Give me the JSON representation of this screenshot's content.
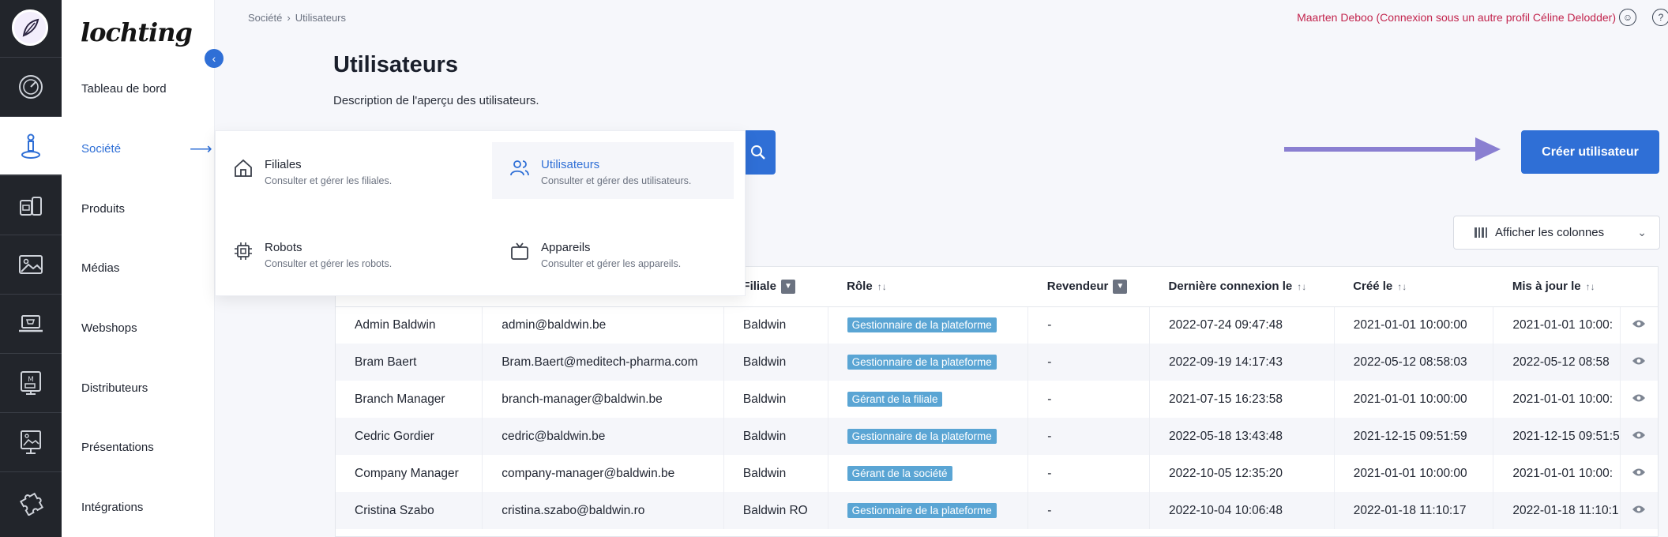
{
  "brand": "lochting",
  "breadcrumb": [
    "Société",
    "Utilisateurs"
  ],
  "user_info": "Maarten Deboo (Connexion sous un autre profil Céline Delodder)",
  "nav": [
    {
      "label": "Tableau de bord"
    },
    {
      "label": "Société"
    },
    {
      "label": "Produits"
    },
    {
      "label": "Médias"
    },
    {
      "label": "Webshops"
    },
    {
      "label": "Distributeurs"
    },
    {
      "label": "Présentations"
    },
    {
      "label": "Intégrations"
    }
  ],
  "page": {
    "title": "Utilisateurs",
    "description": "Description de l'aperçu des utilisateurs.",
    "create_label": "Créer utilisateur",
    "columns_label": "Afficher les colonnes"
  },
  "menu": [
    {
      "title": "Filiales",
      "desc": "Consulter et gérer les filiales."
    },
    {
      "title": "Utilisateurs",
      "desc": "Consulter et gérer des utilisateurs."
    },
    {
      "title": "Robots",
      "desc": "Consulter et gérer les robots."
    },
    {
      "title": "Appareils",
      "desc": "Consulter et gérer les appareils."
    }
  ],
  "table": {
    "headers": [
      "Filiale",
      "Rôle",
      "Revendeur",
      "Dernière connexion le",
      "Créé le",
      "Mis à jour le"
    ],
    "rows": [
      [
        "Admin Baldwin",
        "admin@baldwin.be",
        "Baldwin",
        "Gestionnaire de la plateforme",
        "-",
        "2022-07-24 09:47:48",
        "2021-01-01 10:00:00",
        "2021-01-01 10:00:"
      ],
      [
        "Bram Baert",
        "Bram.Baert@meditech-pharma.com",
        "Baldwin",
        "Gestionnaire de la plateforme",
        "-",
        "2022-09-19 14:17:43",
        "2022-05-12 08:58:03",
        "2022-05-12 08:58"
      ],
      [
        "Branch Manager",
        "branch-manager@baldwin.be",
        "Baldwin",
        "Gérant de la filiale",
        "-",
        "2021-07-15 16:23:58",
        "2021-01-01 10:00:00",
        "2021-01-01 10:00:"
      ],
      [
        "Cedric Gordier",
        "cedric@baldwin.be",
        "Baldwin",
        "Gestionnaire de la plateforme",
        "-",
        "2022-05-18 13:43:48",
        "2021-12-15 09:51:59",
        "2021-12-15 09:51:5"
      ],
      [
        "Company Manager",
        "company-manager@baldwin.be",
        "Baldwin",
        "Gérant de la société",
        "-",
        "2022-10-05 12:35:20",
        "2021-01-01 10:00:00",
        "2021-01-01 10:00:"
      ],
      [
        "Cristina Szabo",
        "cristina.szabo@baldwin.ro",
        "Baldwin RO",
        "Gestionnaire de la plateforme",
        "-",
        "2022-10-04 10:06:48",
        "2022-01-18 11:10:17",
        "2022-01-18 11:10:1"
      ]
    ]
  }
}
